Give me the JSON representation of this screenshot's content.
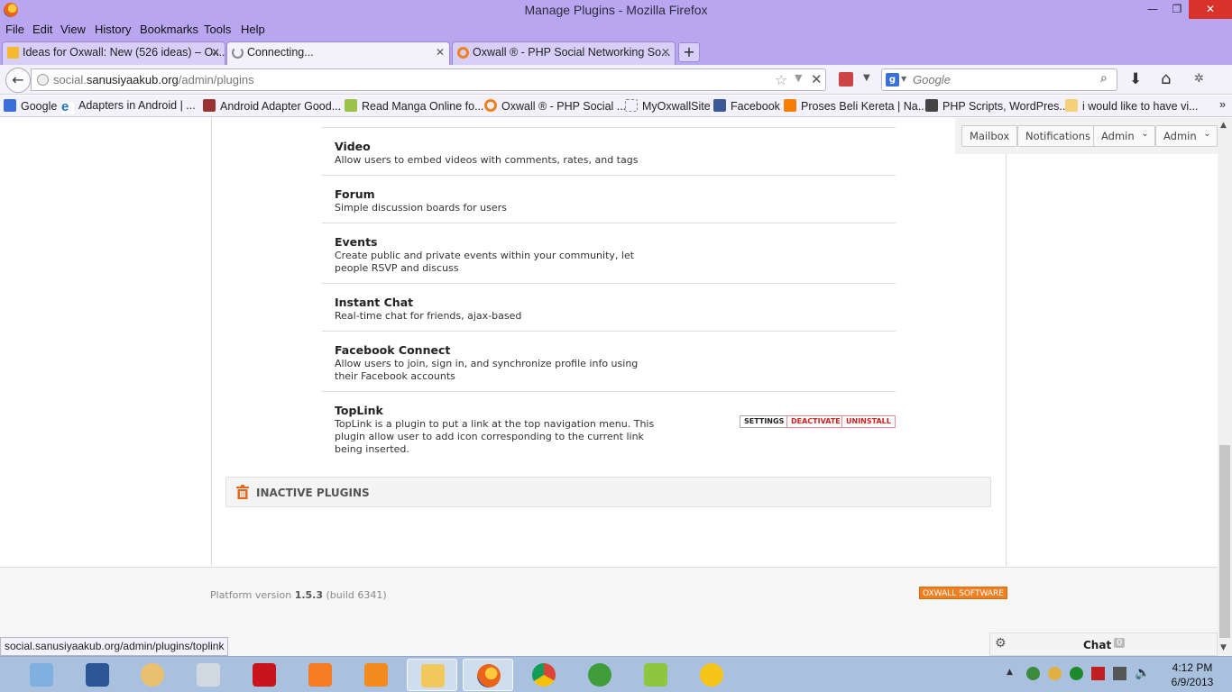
{
  "window": {
    "title": "Manage Plugins - Mozilla Firefox",
    "min": "—",
    "max": "❐",
    "close": "✕"
  },
  "menu": [
    "File",
    "Edit",
    "View",
    "History",
    "Bookmarks",
    "Tools",
    "Help"
  ],
  "tabs": [
    {
      "label": "Ideas for Oxwall: New (526 ideas) – Ox...",
      "close": "✕"
    },
    {
      "label": "Connecting...",
      "close": "✕"
    },
    {
      "label": "Oxwall ® - PHP Social Networking So...",
      "close": "✕"
    }
  ],
  "newtab": "+",
  "address": {
    "prefix": "social.",
    "domain": "sanusiyaakub.org",
    "path": "/admin/plugins"
  },
  "search": {
    "placeholder": "Google"
  },
  "bookmarks": [
    "Google",
    "Adapters in Android | ...",
    "Android Adapter Good...",
    "Read Manga Online fo...",
    "Oxwall ® - PHP Social ...",
    "MyOxwallSite",
    "Facebook",
    "Proses Beli Kereta | Na...",
    "PHP Scripts, WordPres...",
    "i would like to have vi..."
  ],
  "topbar": {
    "mailbox": "Mailbox",
    "notifications": "Notifications",
    "admin1": "Admin",
    "admin2": "Admin"
  },
  "plugins": [
    {
      "name": "Video",
      "desc": "Allow users to embed videos with comments, rates, and tags"
    },
    {
      "name": "Forum",
      "desc": "Simple discussion boards for users"
    },
    {
      "name": "Events",
      "desc": "Create public and private events within your community, let people RSVP and discuss"
    },
    {
      "name": "Instant Chat",
      "desc": "Real-time chat for friends, ajax-based"
    },
    {
      "name": "Facebook Connect",
      "desc": "Allow users to join, sign in, and synchronize profile info using their Facebook accounts"
    },
    {
      "name": "TopLink",
      "desc": "TopLink is a plugin to put a link at the top navigation menu. This plugin allow user to add icon corresponding to the current link being inserted."
    }
  ],
  "toplink_actions": {
    "settings": "SETTINGS",
    "deactivate": "DEACTIVATE",
    "uninstall": "UNINSTALL"
  },
  "inactive_title": "INACTIVE PLUGINS",
  "footer": {
    "platform_label": "Platform version",
    "version": "1.5.3",
    "build": "(build 6341)",
    "badge": "OXWALL SOFTWARE"
  },
  "chat": {
    "label": "Chat",
    "count": "0"
  },
  "status_url": "social.sanusiyaakub.org/admin/plugins/toplink",
  "clock": {
    "time": "4:12 PM",
    "date": "6/9/2013"
  },
  "colors": {
    "titlebar": "#b8a6f0",
    "accent": "#f07f20",
    "danger": "#d02020",
    "taskbar": "#a9c1df"
  }
}
